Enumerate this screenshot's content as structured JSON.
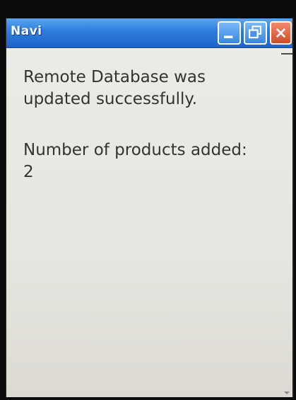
{
  "window": {
    "title": "Navi",
    "buttons": {
      "minimize": "minimize-icon",
      "maximize": "maximize-icon",
      "close": "close-icon"
    }
  },
  "content": {
    "message_lines": [
      "Remote Database was",
      "updated successfully."
    ],
    "count_label": "Number of products added:",
    "count_value": "2"
  },
  "colors": {
    "titlebar": "#2f80de",
    "close_button": "#d54a2a",
    "background": "#e9e8e3",
    "text": "#333333"
  }
}
